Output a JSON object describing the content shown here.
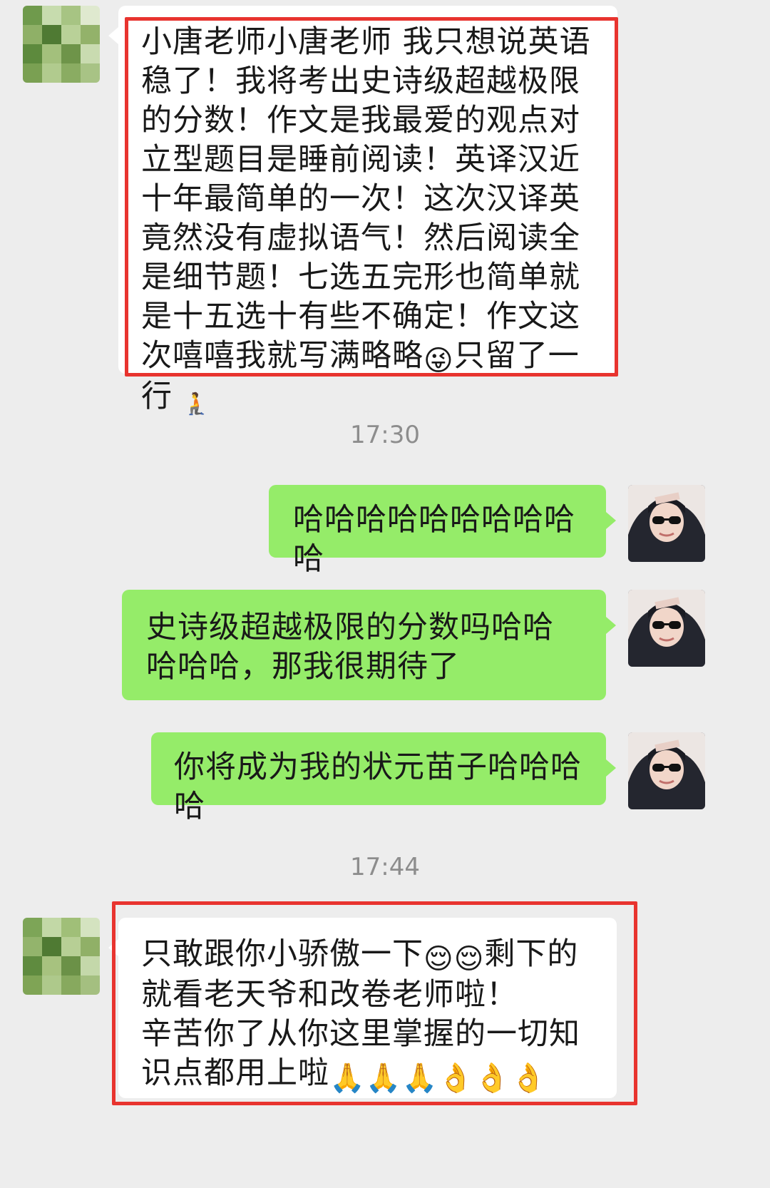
{
  "messages": [
    {
      "text": "小唐老师小唐老师 我只想说英语稳了！我将考出史诗级超越极限的分数！作文是我最爱的观点对立型题目是睡前阅读！英译汉近十年最简单的一次！这次汉译英竟然没有虚拟语气！然后阅读全是细节题！七选五完形也简单就是十五选十有些不确定！作文这次嘻嘻我就写满略略",
      "emoji": "😜",
      "text_after": "只留了一行",
      "emoji_after": "🧎"
    },
    {
      "time": "17:30"
    },
    {
      "text": "哈哈哈哈哈哈哈哈哈哈"
    },
    {
      "text": "史诗级超越极限的分数吗哈哈哈哈哈，那我很期待了"
    },
    {
      "text": "你将成为我的状元苗子哈哈哈哈"
    },
    {
      "time": "17:44"
    },
    {
      "text_part1": "只敢跟你小骄傲一下",
      "emoji": "😌😌",
      "text_part2": "剩下的就看老天爷和改卷老师啦！",
      "text_line3": "辛苦你了从你这里掌握的一切知识点都用上啦",
      "emoji_end": "🙏🙏🙏👌👌👌"
    }
  ],
  "colors": {
    "background": "#ededed",
    "self_bubble": "#95ec69",
    "other_bubble": "#ffffff",
    "highlight_border": "#e8342f",
    "timestamp": "#8d8d8d"
  }
}
